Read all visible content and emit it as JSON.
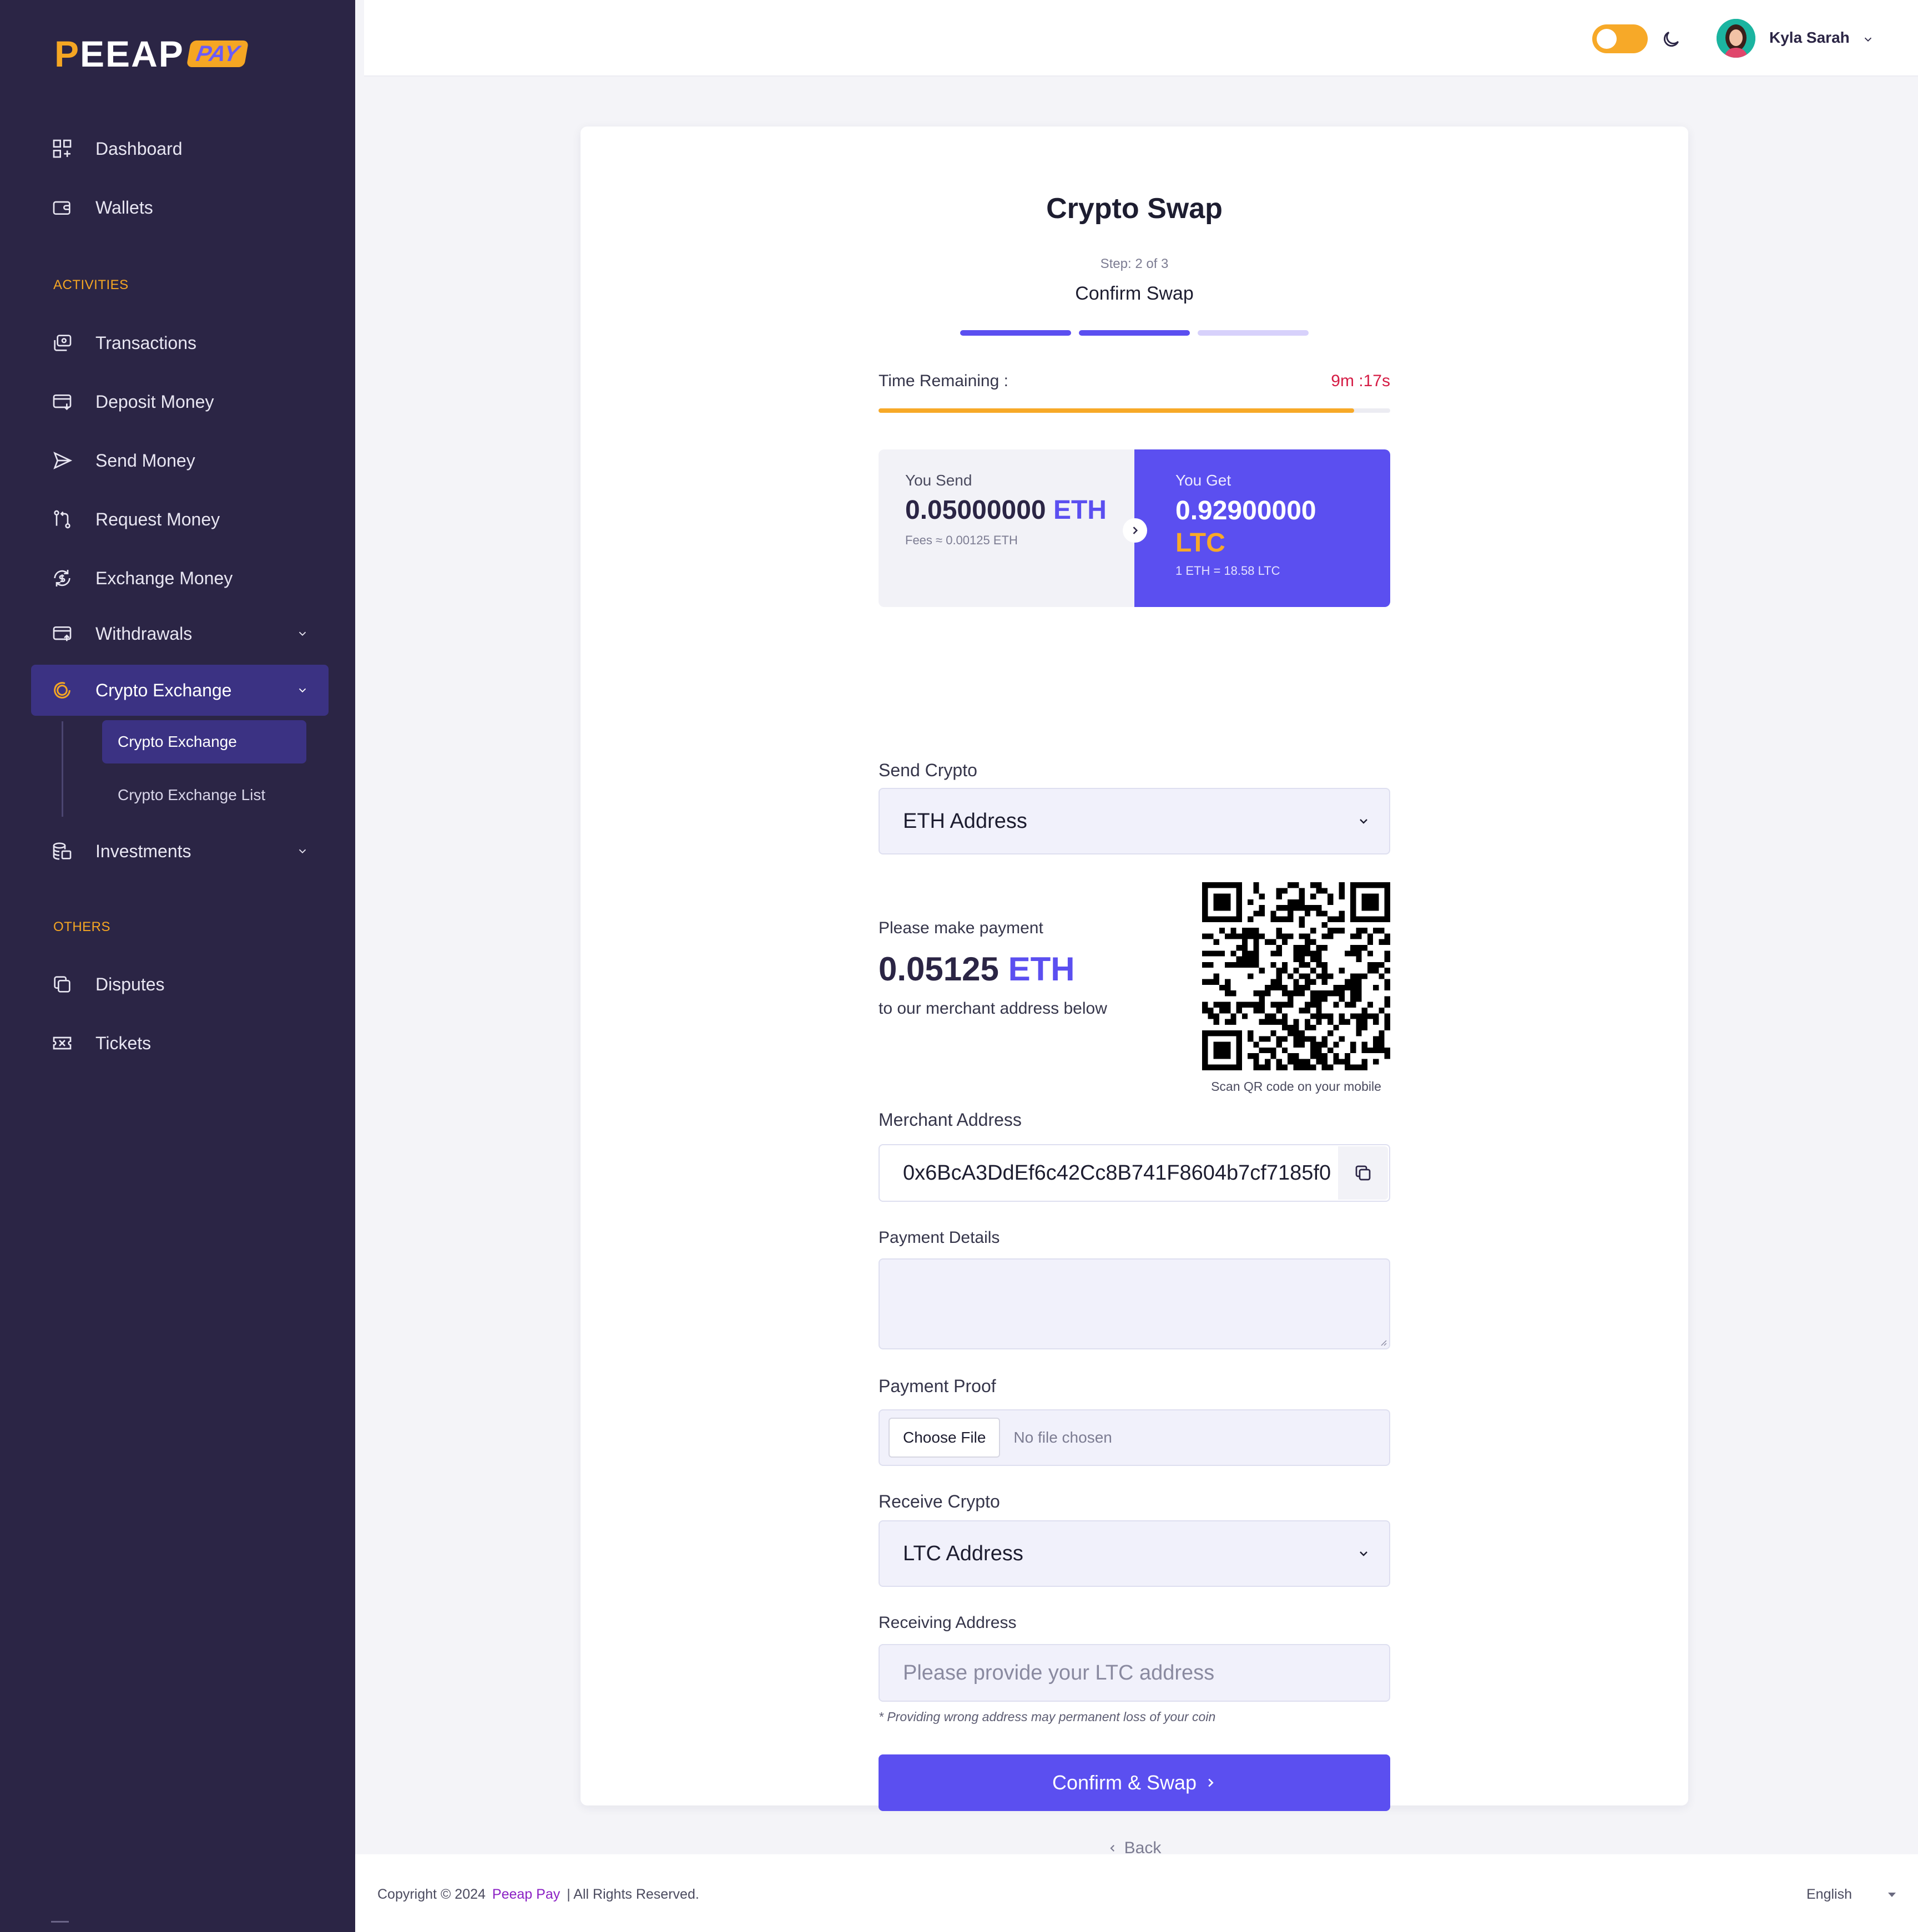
{
  "brand": {
    "logo_main": "PEEAP",
    "logo_sub": "PAY",
    "accent": "#f5a623",
    "primary": "#5b4ff0"
  },
  "sidebar": {
    "items_top": [
      {
        "label": "Dashboard",
        "icon": "dashboard-icon"
      },
      {
        "label": "Wallets",
        "icon": "wallet-icon"
      }
    ],
    "section_activities": "ACTIVITIES",
    "activities": [
      {
        "label": "Transactions",
        "icon": "transactions-icon"
      },
      {
        "label": "Deposit Money",
        "icon": "deposit-icon"
      },
      {
        "label": "Send Money",
        "icon": "send-icon"
      },
      {
        "label": "Request Money",
        "icon": "request-icon"
      },
      {
        "label": "Exchange Money",
        "icon": "exchange-icon"
      },
      {
        "label": "Withdrawals",
        "icon": "withdrawal-icon"
      },
      {
        "label": "Crypto Exchange",
        "icon": "crypto-icon",
        "active": true
      },
      {
        "label": "Investments",
        "icon": "investments-icon"
      }
    ],
    "crypto_sub": [
      {
        "label": "Crypto Exchange",
        "active": true
      },
      {
        "label": "Crypto Exchange List"
      }
    ],
    "section_others": "OTHERS",
    "others": [
      {
        "label": "Disputes",
        "icon": "disputes-icon"
      },
      {
        "label": "Tickets",
        "icon": "tickets-icon"
      }
    ]
  },
  "header": {
    "theme_toggle": "on",
    "user_name": "Kyla Sarah"
  },
  "swap": {
    "title": "Crypto Swap",
    "step_label": "Step: 2 of 3",
    "step_name": "Confirm Swap",
    "steps_total": 3,
    "steps_done": 2,
    "time_label": "Time Remaining :",
    "time_value": "9m :17s",
    "time_progress": 0.93,
    "send": {
      "label": "You Send",
      "amount": "0.05000000",
      "currency": "ETH",
      "note": "Fees ≈ 0.00125 ETH"
    },
    "get": {
      "label": "You Get",
      "amount": "0.92900000",
      "currency": "LTC",
      "note": "1 ETH = 18.58 LTC"
    },
    "send_crypto_label": "Send Crypto",
    "send_crypto_value": "ETH Address",
    "payment": {
      "line1": "Please make payment",
      "amount": "0.05125",
      "currency": "ETH",
      "line3": "to our merchant address below",
      "qr_caption": "Scan QR code on your mobile"
    },
    "merchant_label": "Merchant Address",
    "merchant_address": "0x6BcA3DdEf6c42Cc8B741F8604b7cf7185f0",
    "details_label": "Payment Details",
    "proof_label": "Payment Proof",
    "file_button": "Choose File",
    "file_status": "No file chosen",
    "receive_label": "Receive Crypto",
    "receive_value": "LTC Address",
    "receiving_label": "Receiving Address",
    "receiving_placeholder": "Please provide your LTC address",
    "warning": "* Providing wrong address may permanent loss of your coin",
    "confirm_button": "Confirm & Swap",
    "back_link": "Back"
  },
  "footer": {
    "copyright": "Copyright © 2024",
    "brand": "Peeap Pay",
    "rights": "| All Rights Reserved.",
    "language": "English"
  }
}
